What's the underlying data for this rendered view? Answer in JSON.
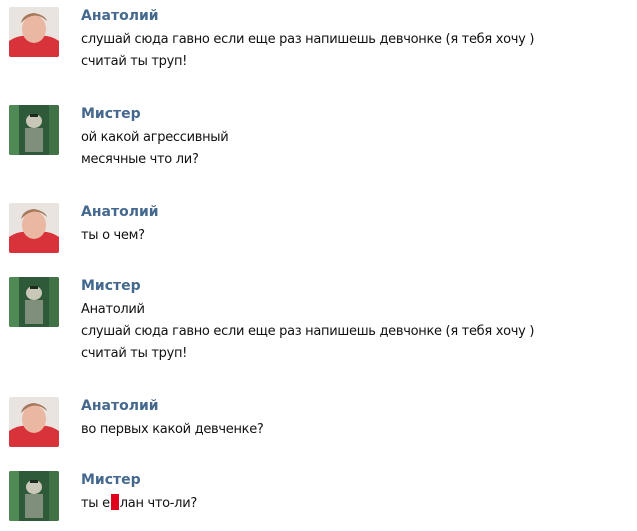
{
  "messages": [
    {
      "author": "Анатолий",
      "avatar": "user-avatar-red-shirt",
      "lines": [
        "слушай сюда гавно если еще раз напишешь девчонке (я тебя хочу )",
        "считай ты труп!"
      ]
    },
    {
      "author": "Мистер",
      "avatar": "user-avatar-green-figure",
      "lines": [
        "ой какой агрессивный",
        "месячные что ли?"
      ]
    },
    {
      "author": "Анатолий",
      "avatar": "user-avatar-red-shirt",
      "lines": [
        "ты о чем?"
      ]
    },
    {
      "author": "Мистер",
      "avatar": "user-avatar-green-figure",
      "lines": [
        "Анатолий",
        "слушай сюда гавно если еще раз напишешь девчонке (я тебя хочу )",
        "считай ты труп!"
      ]
    },
    {
      "author": "Анатолий",
      "avatar": "user-avatar-red-shirt",
      "lines": [
        "во первых какой девченке?"
      ]
    },
    {
      "author": "Мистер",
      "avatar": "user-avatar-green-figure",
      "lines": [],
      "redacted_line": {
        "before": "ты е",
        "after": "лан что-ли?"
      }
    }
  ],
  "colors": {
    "author_name": "#45688e",
    "message_text": "#111111",
    "redaction": "#e0001b"
  }
}
